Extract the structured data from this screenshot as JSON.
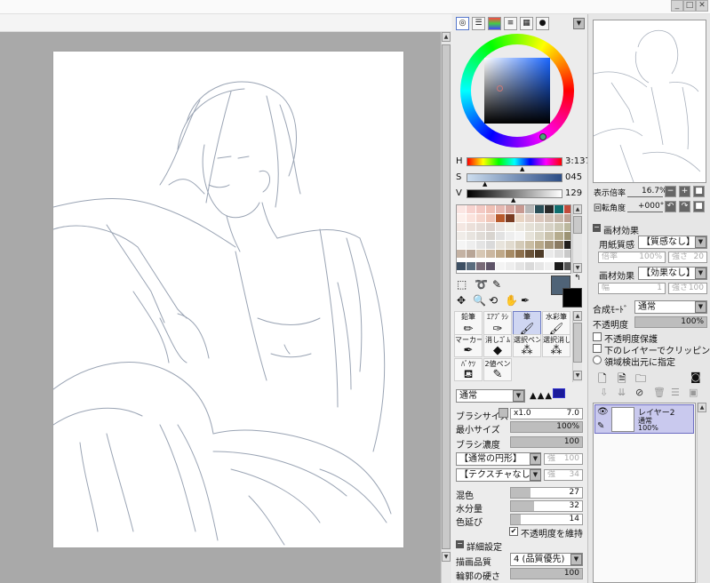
{
  "window": {
    "minimize": "_",
    "restore": "□",
    "close": "✕"
  },
  "color_panel": {
    "mode_icons": [
      "wheel",
      "hsv",
      "rgb",
      "bars",
      "grid",
      "scratch"
    ],
    "h_label": "H",
    "h_value": "137",
    "s_label": "S",
    "s_value": "045",
    "v_label": "V",
    "v_value": "129",
    "colors": {
      "main": "#4f6377",
      "sub": "#000000"
    }
  },
  "navigator": {
    "zoom_label": "表示倍率",
    "zoom_value": "16.7%",
    "rotate_label": "回転角度",
    "rotate_value": "+000°"
  },
  "tools": [
    {
      "name": "鉛筆",
      "icon": "pencil-icon"
    },
    {
      "name": "ｴｱﾌﾞﾗｼ",
      "icon": "airbrush-icon"
    },
    {
      "name": "筆",
      "icon": "brush-icon"
    },
    {
      "name": "水彩筆",
      "icon": "watercolor-icon"
    },
    {
      "name": "マーカー",
      "icon": "marker-icon"
    },
    {
      "name": "消しｺﾞﾑ",
      "icon": "eraser-icon"
    },
    {
      "name": "選択ペン",
      "icon": "select-pen-icon"
    },
    {
      "name": "選択消し",
      "icon": "select-eraser-icon"
    },
    {
      "name": "ﾊﾞｹﾂ",
      "icon": "bucket-icon"
    },
    {
      "name": "2値ペン",
      "icon": "binary-pen-icon"
    }
  ],
  "brush": {
    "blend_mode": "通常",
    "size_label": "ブラシサイズ",
    "size_mult": "x1.0",
    "size_value": "7.0",
    "min_size_label": "最小サイズ",
    "min_size_value": "100%",
    "density_label": "ブラシ濃度",
    "density_value": "100",
    "shape": "【通常の円形】",
    "shape_strength_label": "強",
    "shape_strength": "100",
    "texture": "【テクスチャなし】",
    "texture_strength_label": "強",
    "texture_strength": "34",
    "mix_label": "混色",
    "mix_value": "27",
    "water_label": "水分量",
    "water_value": "32",
    "stretch_label": "色延び",
    "stretch_value": "14",
    "keep_opacity_label": "不透明度を維持",
    "advanced_label": "詳細設定",
    "quality_label": "描画品質",
    "quality_value": "4 (品質優先)",
    "edge_label": "輪郭の硬さ",
    "edge_value": "100"
  },
  "layer_panel": {
    "texture_effect_header": "画材効果",
    "paper_label": "用紙質感",
    "paper_value": "【質感なし】",
    "paper_fields": [
      "倍率",
      "100%",
      "強さ",
      "20"
    ],
    "effect_label": "画材効果",
    "effect_value": "【効果なし】",
    "effect_fields": [
      "幅",
      "1",
      "強さ",
      "100"
    ],
    "blend_label": "合成ﾓｰﾄﾞ",
    "blend_value": "通常",
    "opacity_label": "不透明度",
    "opacity_value": "100%",
    "options": [
      "不透明度保護",
      "下のレイヤーでクリッピング",
      "領域検出元に指定"
    ],
    "layer": {
      "name": "レイヤー2",
      "mode": "通常",
      "opacity": "100%"
    }
  }
}
